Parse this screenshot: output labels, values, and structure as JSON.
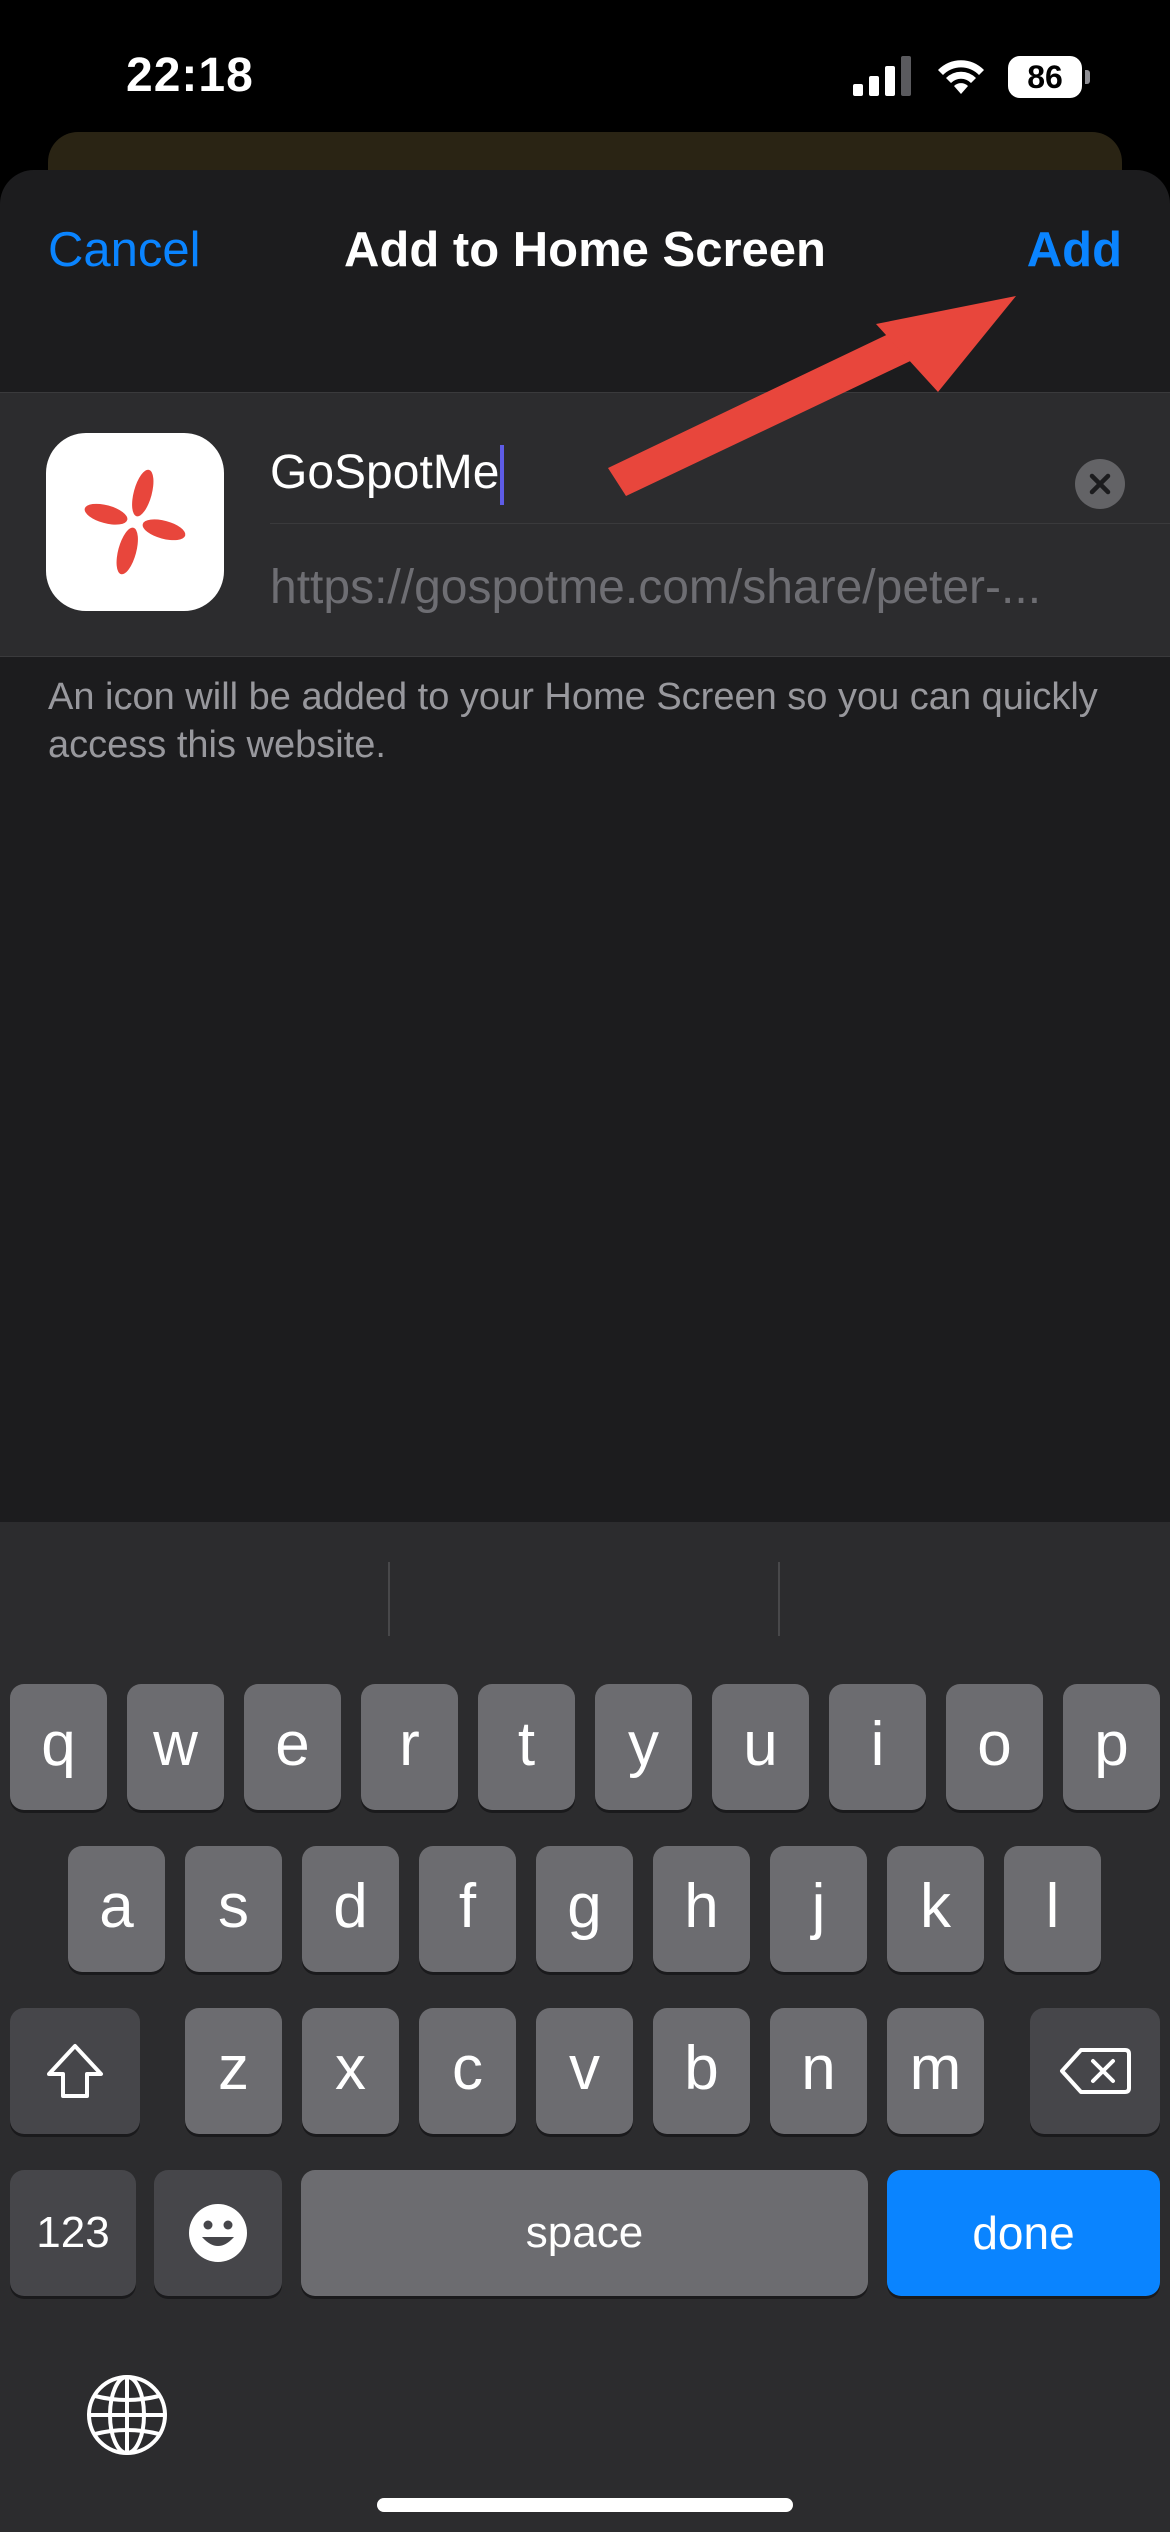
{
  "status_bar": {
    "time": "22:18",
    "battery": "86"
  },
  "sheet": {
    "cancel_label": "Cancel",
    "title": "Add to Home Screen",
    "add_label": "Add",
    "name_value": "GoSpotMe",
    "url_value": "https://gospotme.com/share/peter-...",
    "footnote": "An icon will be added to your Home Screen so you can quickly access this website.",
    "icon_name": "gospotme-logo-icon"
  },
  "keyboard": {
    "row1": [
      "q",
      "w",
      "e",
      "r",
      "t",
      "y",
      "u",
      "i",
      "o",
      "p"
    ],
    "row2": [
      "a",
      "s",
      "d",
      "f",
      "g",
      "h",
      "j",
      "k",
      "l"
    ],
    "row3": [
      "z",
      "x",
      "c",
      "v",
      "b",
      "n",
      "m"
    ],
    "numbers_label": "123",
    "space_label": "space",
    "done_label": "done"
  },
  "colors": {
    "accent": "#0a84ff",
    "arrow": "#e8463c",
    "sheet_bg": "#1c1c1e"
  }
}
